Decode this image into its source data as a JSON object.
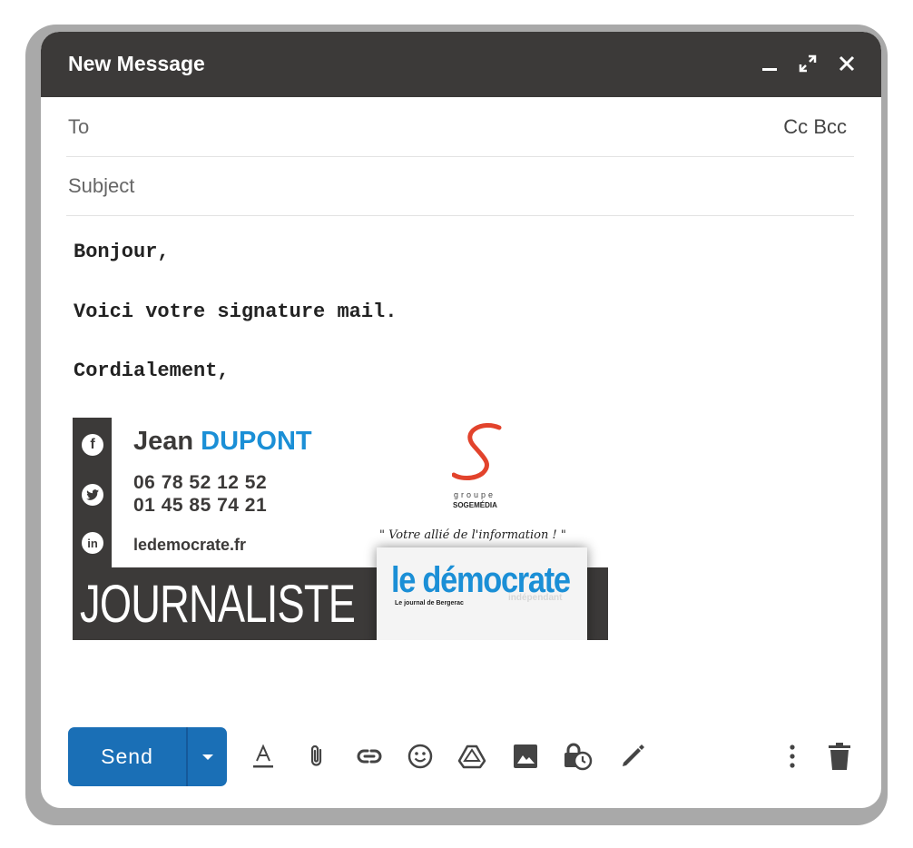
{
  "window": {
    "title": "New Message",
    "controls": [
      "minimize-icon",
      "expand-icon",
      "close-icon"
    ]
  },
  "to_field": {
    "label": "To",
    "cc": "Cc",
    "bcc": "Bcc"
  },
  "subject_field": {
    "placeholder": "Subject"
  },
  "message": {
    "line1": "Bonjour,",
    "line2": "Voici votre signature mail.",
    "line3": "Cordialement,"
  },
  "signature": {
    "first_name": "Jean",
    "last_name": "DUPONT",
    "phone1": "06 78 52 12 52",
    "phone2": "01 45 85 74 21",
    "website": "ledemocrate.fr",
    "job_title": "JOURNALISTE",
    "logo_groupe": "groupe",
    "logo_company": "SOGEMÉDIA",
    "slogan": "\" Votre allié de l'information ! \"",
    "paper_name": "le démocrate",
    "paper_subtitle": "Le journal de Bergerac",
    "paper_tag": "indépendant",
    "colors": {
      "dark": "#3c3a39",
      "accent": "#1b8fd6",
      "logo_red": "#e2432c"
    },
    "social_icons": [
      "facebook-icon",
      "twitter-icon",
      "linkedin-icon"
    ]
  },
  "toolbar": {
    "send_label": "Send",
    "tools": [
      "format-text-icon",
      "attach-icon",
      "link-icon",
      "emoji-icon",
      "drive-icon",
      "photo-icon",
      "confidential-icon",
      "signature-icon",
      "more-options-icon",
      "discard-icon"
    ],
    "send_color": "#1a6fb6"
  }
}
